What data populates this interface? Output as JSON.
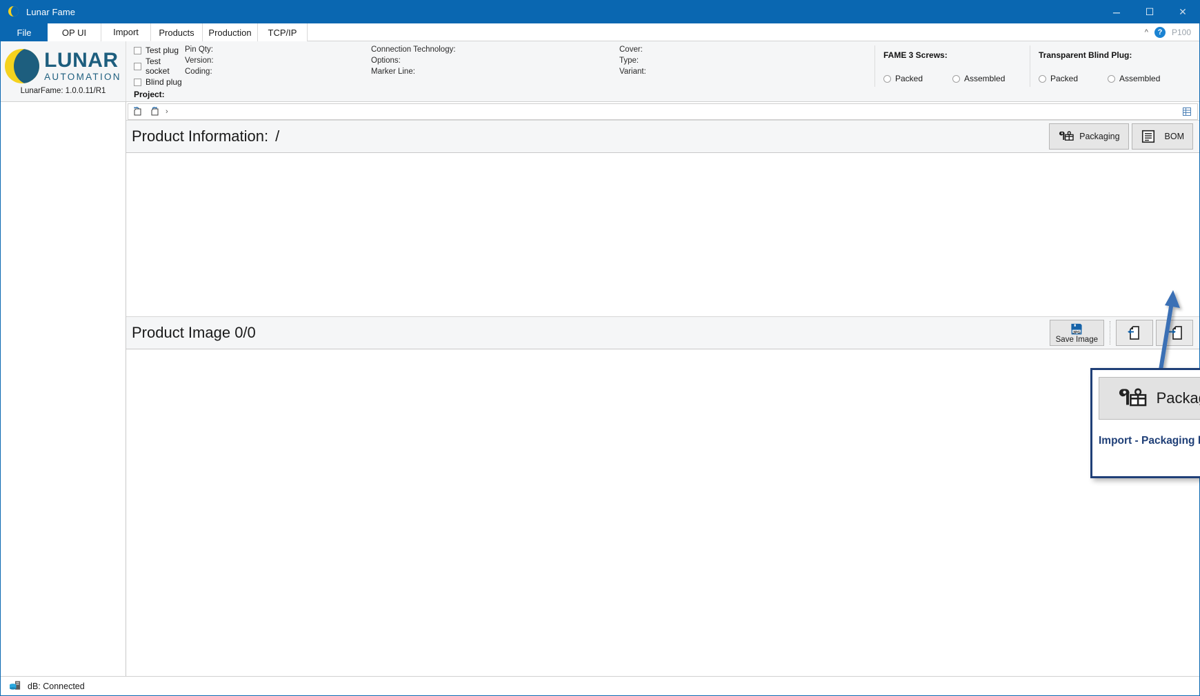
{
  "window": {
    "title": "Lunar Fame",
    "app_icon": "moon-icon",
    "minimize": "─",
    "maximize": "☐",
    "close": "✕"
  },
  "tabs": [
    {
      "label": "File",
      "active": false,
      "kind": "file"
    },
    {
      "label": "OP UI",
      "active": false
    },
    {
      "label": "Import",
      "active": true
    },
    {
      "label": "Products",
      "active": false
    },
    {
      "label": "Production",
      "active": false
    },
    {
      "label": "TCP/IP",
      "active": false
    }
  ],
  "tab_right": {
    "collapse_icon": "chevron-up-icon",
    "help_icon": "help-icon",
    "help_glyph": "?",
    "user_label": "P100"
  },
  "brand": {
    "name_line1": "LUNAR",
    "name_line2": "AUTOMATION",
    "version": "LunarFame: 1.0.0.11/R1",
    "moon_yellow": "#f5d21e",
    "moon_blue": "#1d5e7e"
  },
  "ribbon": {
    "checkboxes": [
      {
        "label": "Test plug",
        "checked": false
      },
      {
        "label": "Test socket",
        "checked": false
      },
      {
        "label": "Blind plug",
        "checked": false
      }
    ],
    "fields_col1": [
      {
        "label": "Pin Qty:",
        "value": ""
      },
      {
        "label": "Version:",
        "value": ""
      },
      {
        "label": "Coding:",
        "value": ""
      }
    ],
    "fields_col2": [
      {
        "label": "Connection Technology:",
        "value": ""
      },
      {
        "label": "Options:",
        "value": ""
      },
      {
        "label": "Marker Line:",
        "value": ""
      }
    ],
    "fields_col3": [
      {
        "label": "Cover:",
        "value": ""
      },
      {
        "label": "Type:",
        "value": ""
      },
      {
        "label": "Variant:",
        "value": ""
      }
    ],
    "panels": [
      {
        "title": "FAME 3 Screws:",
        "options": [
          {
            "label": "Packed",
            "selected": false
          },
          {
            "label": "Assembled",
            "selected": false
          }
        ]
      },
      {
        "title": "Transparent Blind Plug:",
        "options": [
          {
            "label": "Packed",
            "selected": false
          },
          {
            "label": "Assembled",
            "selected": false
          }
        ]
      }
    ],
    "project_label": "Project:",
    "project_value": ""
  },
  "breadcrumb": {
    "back_icon": "navigate-back-folder-icon",
    "forward_icon": "navigate-forward-folder-icon",
    "separator": "›",
    "path": "",
    "grid_icon": "grid-view-icon"
  },
  "product_information": {
    "title": "Product Information:",
    "path_value": "/",
    "buttons": [
      {
        "label": "Packaging",
        "icon": "packaging-gift-wrench-icon"
      },
      {
        "label": "BOM",
        "icon": "bom-list-icon"
      }
    ]
  },
  "product_image": {
    "title": "Product Image 0/0",
    "current": 0,
    "total": 0,
    "save_button": {
      "label": "Save Image",
      "icon": "save-jpg-icon",
      "format": "JPG"
    },
    "prev_button": {
      "label": "",
      "icon": "previous-page-icon"
    },
    "next_button": {
      "label": "",
      "icon": "next-page-icon"
    }
  },
  "annotation": {
    "arrow_icon": "pointer-arrow-icon",
    "arrow_color": "#3a6fb5",
    "border_color": "#1f3f77",
    "zoom_button_label": "Packaging",
    "zoom_button_icon": "packaging-gift-wrench-icon",
    "caption": "Import - Packaging button"
  },
  "statusbar": {
    "icon": "database-connected-icon",
    "text": "dB: Connected"
  }
}
